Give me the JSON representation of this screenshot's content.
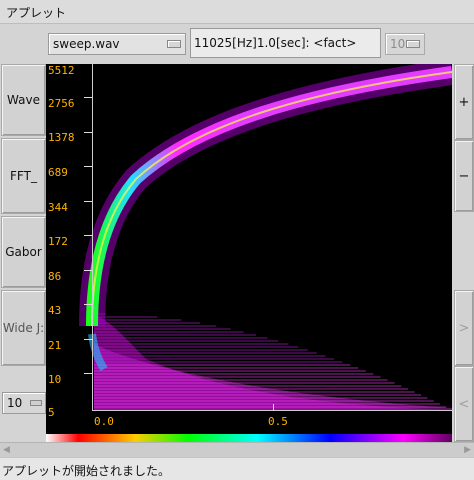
{
  "window": {
    "title": "アプレット"
  },
  "toolbar": {
    "file_select": "sweep.wav",
    "info": "11025[Hz]1.0[sec]: <fact>",
    "number_select": "10"
  },
  "left_panel": {
    "buttons": [
      "Wave",
      "FFT_",
      "Gabor",
      "Wide J:"
    ],
    "count_select": "10"
  },
  "right_panel": {
    "buttons": [
      "+",
      "−",
      ">",
      "<"
    ]
  },
  "plot": {
    "y_ticks": [
      "5512",
      "2756",
      "1378",
      "689",
      "344",
      "172",
      "86",
      "43",
      "21",
      "10",
      "5"
    ],
    "x_ticks": [
      "0.0",
      "0.5"
    ],
    "colors": {
      "background": "#000000",
      "label": "#ffb300"
    }
  },
  "status": {
    "text": "アプレットが開始されました。"
  },
  "icons": {
    "scroll_left": "triangle-left-icon",
    "scroll_right": "triangle-right-icon"
  }
}
